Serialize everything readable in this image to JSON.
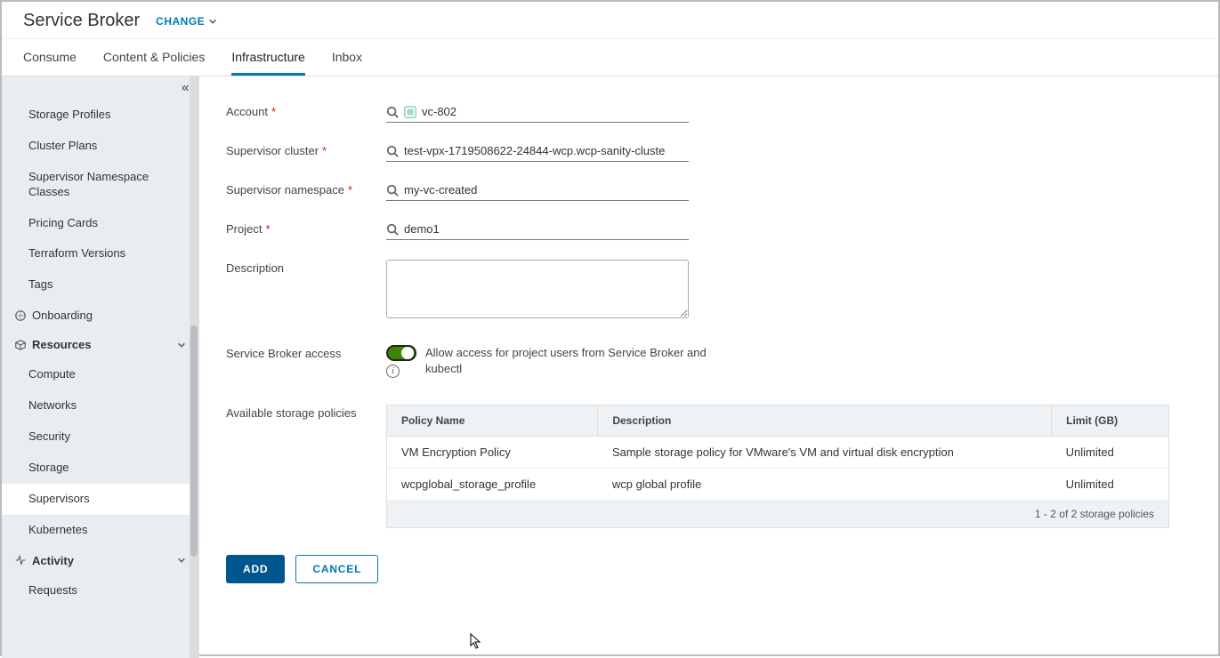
{
  "header": {
    "title": "Service Broker",
    "change": "CHANGE"
  },
  "tabs": {
    "consume": "Consume",
    "content": "Content & Policies",
    "infra": "Infrastructure",
    "inbox": "Inbox",
    "active": "infra"
  },
  "sidebar": {
    "top_items": [
      "Storage Profiles",
      "Cluster Plans",
      "Supervisor Namespace Classes",
      "Pricing Cards",
      "Terraform Versions",
      "Tags"
    ],
    "onboarding": "Onboarding",
    "resources": {
      "label": "Resources",
      "items": [
        "Compute",
        "Networks",
        "Security",
        "Storage",
        "Supervisors",
        "Kubernetes"
      ],
      "active": "Supervisors"
    },
    "activity": {
      "label": "Activity",
      "items": [
        "Requests"
      ]
    }
  },
  "form": {
    "account": {
      "label": "Account",
      "value": "vc-802"
    },
    "cluster": {
      "label": "Supervisor cluster",
      "value": "test-vpx-1719508622-24844-wcp.wcp-sanity-cluste"
    },
    "namespace": {
      "label": "Supervisor namespace",
      "value": "my-vc-created"
    },
    "project": {
      "label": "Project",
      "value": "demo1"
    },
    "description": {
      "label": "Description",
      "value": ""
    },
    "access": {
      "label": "Service Broker access",
      "text": "Allow access for project users from Service Broker and kubectl"
    },
    "policies": {
      "label": "Available storage policies"
    }
  },
  "table": {
    "headers": {
      "name": "Policy Name",
      "desc": "Description",
      "limit": "Limit (GB)"
    },
    "rows": [
      {
        "name": "VM Encryption Policy",
        "desc": "Sample storage policy for VMware's VM and virtual disk encryption",
        "limit": "Unlimited"
      },
      {
        "name": "wcpglobal_storage_profile",
        "desc": "wcp global profile",
        "limit": "Unlimited"
      }
    ],
    "footer": "1 - 2 of 2 storage policies"
  },
  "actions": {
    "add": "ADD",
    "cancel": "CANCEL"
  }
}
